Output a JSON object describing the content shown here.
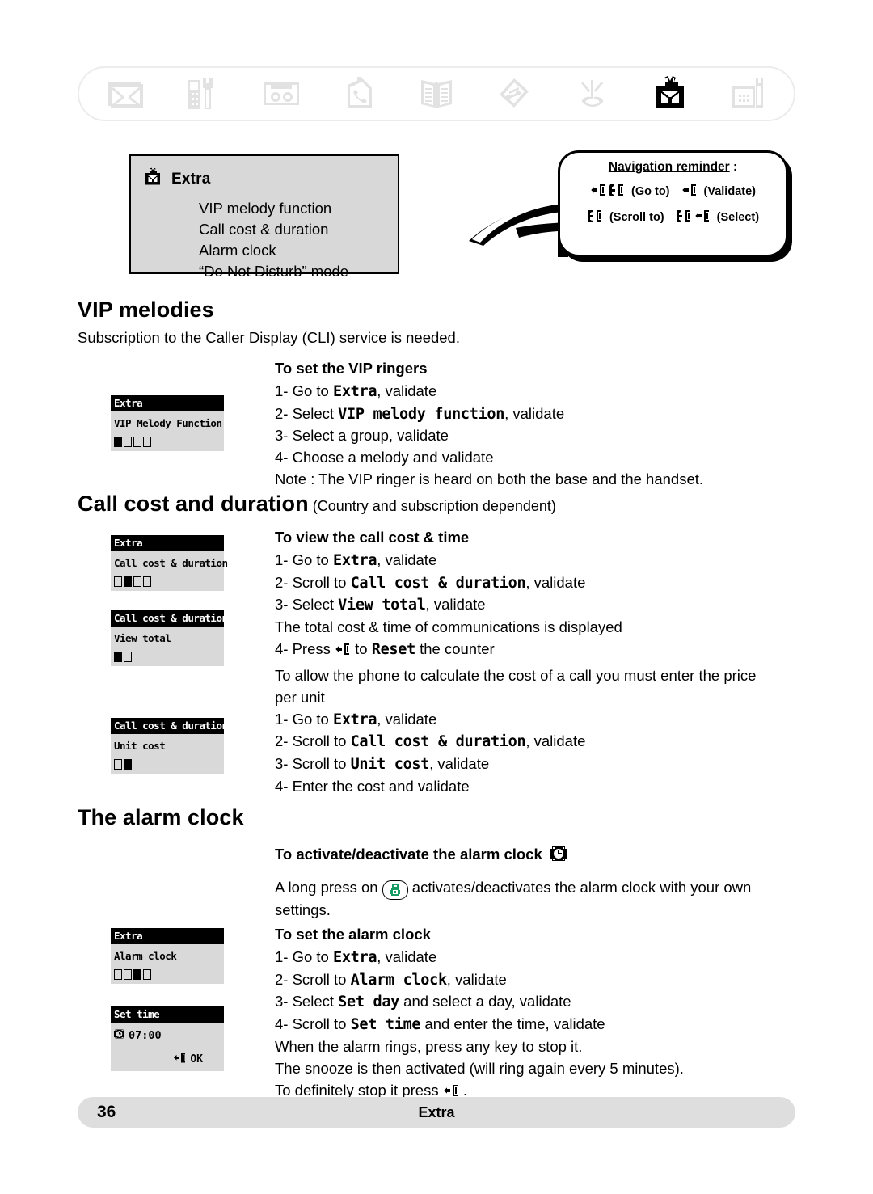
{
  "nav_icons": [
    {
      "name": "envelope-icon",
      "label": "Messages",
      "active": false
    },
    {
      "name": "handset-settings-icon",
      "label": "Handset settings",
      "active": false
    },
    {
      "name": "answering-machine-icon",
      "label": "Answering machine",
      "active": false
    },
    {
      "name": "call-log-icon",
      "label": "Call log",
      "active": false
    },
    {
      "name": "phonebook-icon",
      "label": "Phonebook",
      "active": false
    },
    {
      "name": "melodies-icon",
      "label": "Melodies",
      "active": false
    },
    {
      "name": "network-services-icon",
      "label": "Network services",
      "active": false
    },
    {
      "name": "gift-extra-icon",
      "label": "Extra",
      "active": true
    },
    {
      "name": "base-settings-icon",
      "label": "Base settings",
      "active": false
    }
  ],
  "extra_menu": {
    "icon": "gift-icon",
    "title": "Extra",
    "items": [
      "VIP melody function",
      "Call cost & duration",
      "Alarm clock",
      "“Do Not Disturb” mode"
    ]
  },
  "navigation_reminder": {
    "title": "Navigation reminder",
    "title_colon": " :",
    "entries": [
      {
        "keys": [
          "validate-key",
          "scroll-key"
        ],
        "label": "(Go to)"
      },
      {
        "keys": [
          "validate-key"
        ],
        "label": "(Validate)"
      },
      {
        "keys": [
          "scroll-key"
        ],
        "label": "(Scroll to)"
      },
      {
        "keys": [
          "scroll-key",
          "validate-key"
        ],
        "label": "(Select)"
      }
    ]
  },
  "sections": {
    "vip": {
      "heading": "VIP melodies",
      "intro": "Subscription to the Caller Display (CLI) service is needed.",
      "subheading": "To set the VIP ringers",
      "steps": [
        {
          "num": "1- ",
          "pre": "Go to ",
          "device": "Extra",
          "post": ", validate"
        },
        {
          "num": "2- ",
          "pre": "Select ",
          "device": "VIP melody function",
          "post": ", validate"
        },
        {
          "num": "3- ",
          "pre": "Select a group, validate",
          "device": "",
          "post": ""
        },
        {
          "num": "4- ",
          "pre": "Choose a melody and validate",
          "device": "",
          "post": ""
        }
      ],
      "note": "Note : The VIP ringer is heard on both the base and the handset.",
      "lcd": {
        "bar": "Extra",
        "line": "VIP Melody Function",
        "dots": 4,
        "active": 1
      }
    },
    "call_cost": {
      "heading": "Call cost and duration",
      "heading_sub": " (Country and subscription dependent)",
      "subheading": "To view the call cost & time",
      "steps": [
        {
          "num": "1- ",
          "pre": "Go to ",
          "device": "Extra",
          "post": ", validate"
        },
        {
          "num": "2- ",
          "pre": "Scroll to ",
          "device": "Call cost & duration",
          "post": ", validate"
        },
        {
          "num": "3- ",
          "pre": "Select ",
          "device": "View total",
          "post": ", validate"
        }
      ],
      "result": "The total cost & time of communications is displayed",
      "step4": {
        "num": "4- ",
        "pre": "Press ",
        "mid": " to ",
        "device": "Reset",
        "post": " the counter"
      },
      "para2_line1": "To allow the phone to calculate the cost of a call you must enter the price",
      "para2_line2": "per unit",
      "steps2": [
        {
          "num": "1- ",
          "pre": "Go to ",
          "device": "Extra",
          "post": ", validate"
        },
        {
          "num": "2- ",
          "pre": "Scroll to ",
          "device": "Call cost & duration",
          "post": ", validate"
        },
        {
          "num": "3- ",
          "pre": "Scroll to ",
          "device": "Unit cost",
          "post": ", validate"
        },
        {
          "num": "4- ",
          "pre": "Enter the cost and validate",
          "device": "",
          "post": ""
        }
      ],
      "lcd1": {
        "bar": "Extra",
        "line": "Call cost & duration",
        "dots": 4,
        "active": 2
      },
      "lcd2": {
        "bar": "Call cost & duration",
        "line": "View total",
        "dots": 2,
        "active": 1
      },
      "lcd3": {
        "bar": "Call cost & duration",
        "line": "Unit cost",
        "dots": 2,
        "active": 2
      }
    },
    "alarm": {
      "heading": "The alarm clock",
      "subheading1": "To activate/deactivate the alarm clock",
      "activate_pre": "A long press on ",
      "activate_post": " activates/deactivates the alarm clock with your own",
      "activate_line2": "settings.",
      "subheading2": "To set the alarm clock",
      "steps": [
        {
          "num": "1- ",
          "pre": "Go to ",
          "device": "Extra",
          "post": ", validate"
        },
        {
          "num": "2- ",
          "pre": "Scroll to ",
          "device": "Alarm clock",
          "post": ", validate"
        },
        {
          "num": "3- ",
          "pre": "Select ",
          "device": "Set day",
          "post": " and select a day, validate"
        },
        {
          "num": "4- ",
          "pre": "Scroll to ",
          "device": "Set time",
          "post": " and enter the time, validate"
        }
      ],
      "note1": "When the alarm rings, press any key to stop it.",
      "note2": "The snooze is then activated (will ring again every 5 minutes).",
      "note3_pre": "To definitely stop it press ",
      "note3_post": " .",
      "lcd1": {
        "bar": "Extra",
        "line": "Alarm clock",
        "dots": 4,
        "active": 3
      },
      "lcd2": {
        "bar": "Set time",
        "time": "07:00",
        "ok": "OK"
      }
    }
  },
  "footer": {
    "page": "36",
    "title": "Extra"
  },
  "colors": {
    "lcd_body": "#d9d9d9",
    "lcd_bar": "#000000",
    "menu_box": "#d8d8d8",
    "icon_inactive": "#e2e2e2",
    "icon_active": "#000000",
    "footer_bg": "#dedede",
    "alarm_key_green": "#169b62"
  }
}
